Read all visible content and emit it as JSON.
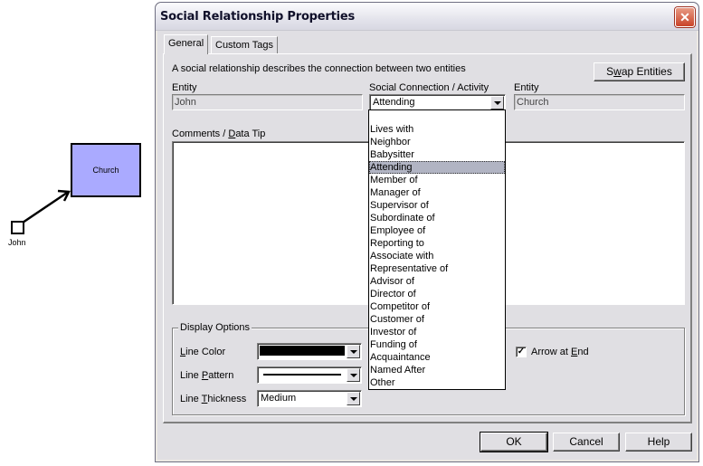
{
  "canvas": {
    "nodes": [
      {
        "label": "Church",
        "fill": "#aaaaff"
      },
      {
        "label": "John"
      }
    ]
  },
  "dialog": {
    "title": "Social Relationship Properties",
    "close_icon": "close-icon",
    "tabs": [
      {
        "label": "General",
        "active": true
      },
      {
        "label": "Custom Tags",
        "active": false
      }
    ],
    "description": "A social relationship describes the connection between two entities",
    "swap_button": {
      "prefix": "S",
      "underlined": "w",
      "suffix": "ap Entities"
    },
    "entity_left": {
      "label": "Entity",
      "value": "John"
    },
    "connection": {
      "label": "Social Connection / Activity",
      "value": "Attending",
      "options": [
        "",
        "Lives with",
        "Neighbor",
        "Babysitter",
        "Attending",
        "Member of",
        "Manager of",
        "Supervisor of",
        "Subordinate of",
        "Employee of",
        "Reporting to",
        "Associate with",
        "Representative of",
        "Advisor of",
        "Director of",
        "Competitor of",
        "Customer of",
        "Investor of",
        "Funding of",
        "Acquaintance",
        "Named After",
        "Other"
      ],
      "selected_index": 4
    },
    "entity_right": {
      "label": "Entity",
      "value": "Church"
    },
    "comments": {
      "prefix": "Comments / ",
      "underlined": "D",
      "suffix": "ata Tip",
      "value": ""
    },
    "display_options": {
      "title": "Display Options",
      "line_color": {
        "underlined": "L",
        "rest": "ine Color",
        "value_color": "#000000"
      },
      "line_pattern": {
        "prefix": "Line ",
        "underlined": "P",
        "rest": "attern",
        "value": "solid"
      },
      "line_thickness": {
        "prefix": "Line ",
        "underlined": "T",
        "rest": "hickness",
        "value": "Medium"
      },
      "arrow_at_end": {
        "prefix": "Arrow at ",
        "underlined": "E",
        "rest": "nd",
        "checked": true
      }
    },
    "buttons": {
      "ok": "OK",
      "cancel": "Cancel",
      "help": "Help"
    }
  }
}
